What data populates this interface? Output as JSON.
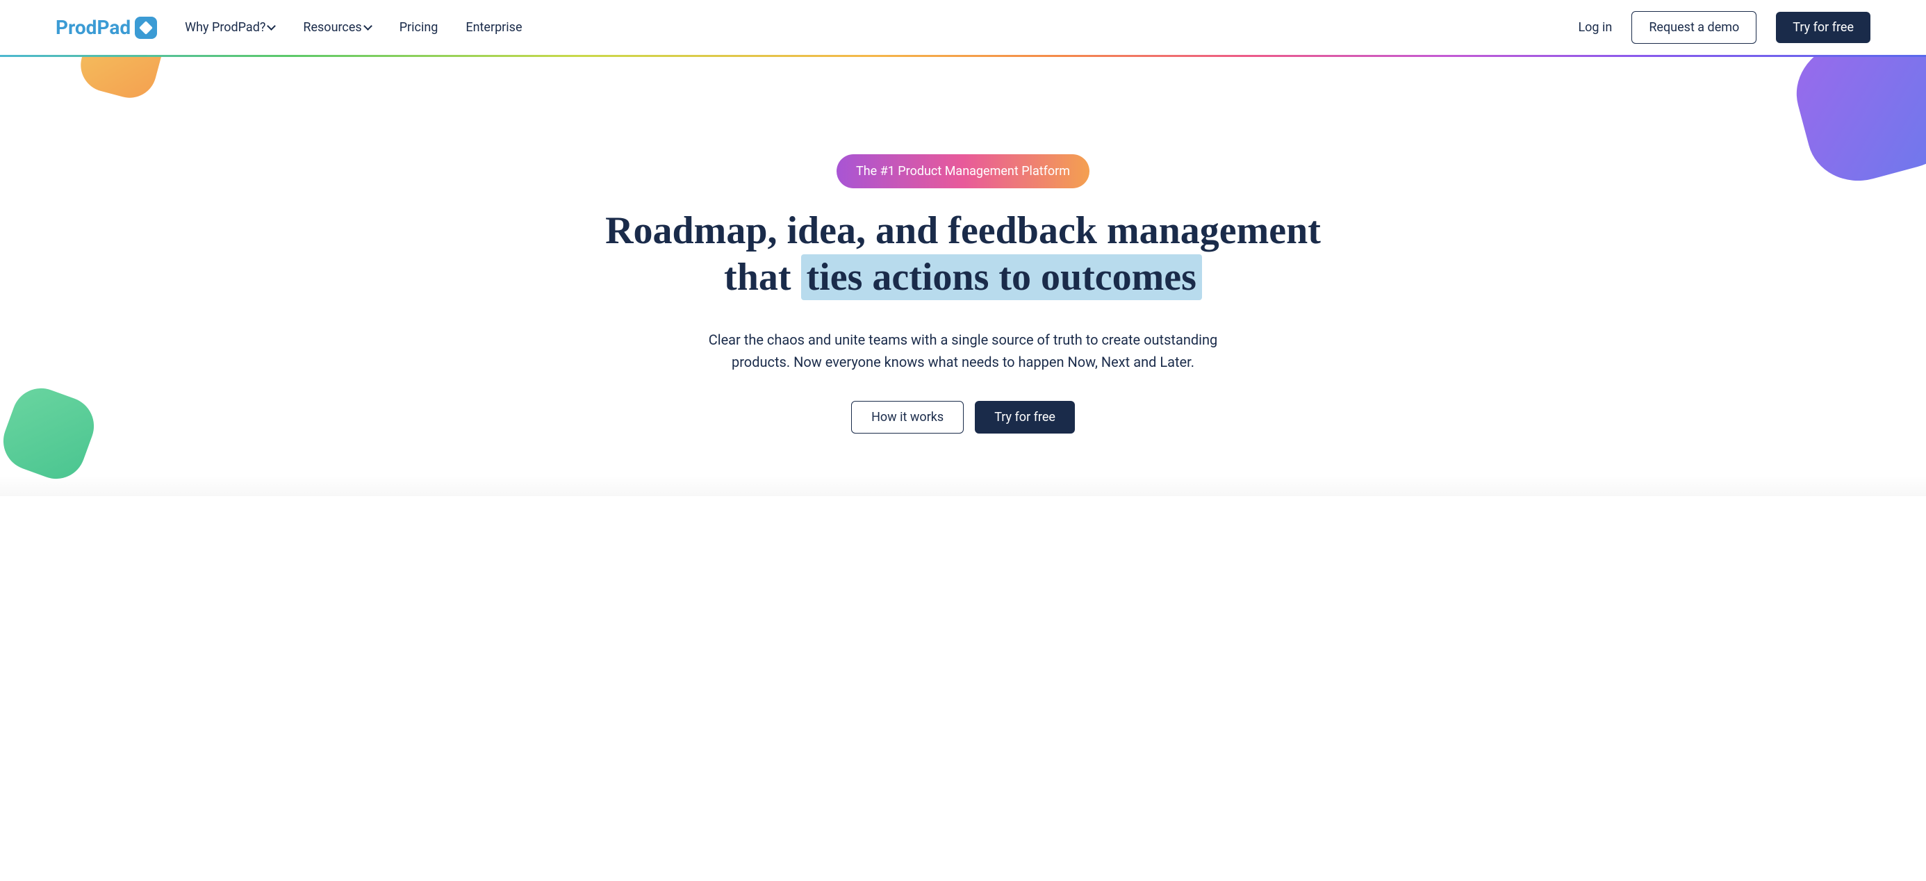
{
  "logo": {
    "text": "ProdPad"
  },
  "nav": {
    "why": "Why ProdPad?",
    "resources": "Resources",
    "pricing": "Pricing",
    "enterprise": "Enterprise"
  },
  "header_actions": {
    "login": "Log in",
    "demo": "Request a demo",
    "try": "Try for free"
  },
  "hero": {
    "badge": "The #1 Product Management Platform",
    "title_part1": "Roadmap, idea, and feedback management that ",
    "title_highlight": "ties actions to outcomes",
    "subtitle": "Clear the chaos and unite teams with a single source of truth to create outstanding products. Now everyone knows what needs to happen Now, Next and Later.",
    "how_it_works": "How it works",
    "try_free": "Try for free"
  }
}
